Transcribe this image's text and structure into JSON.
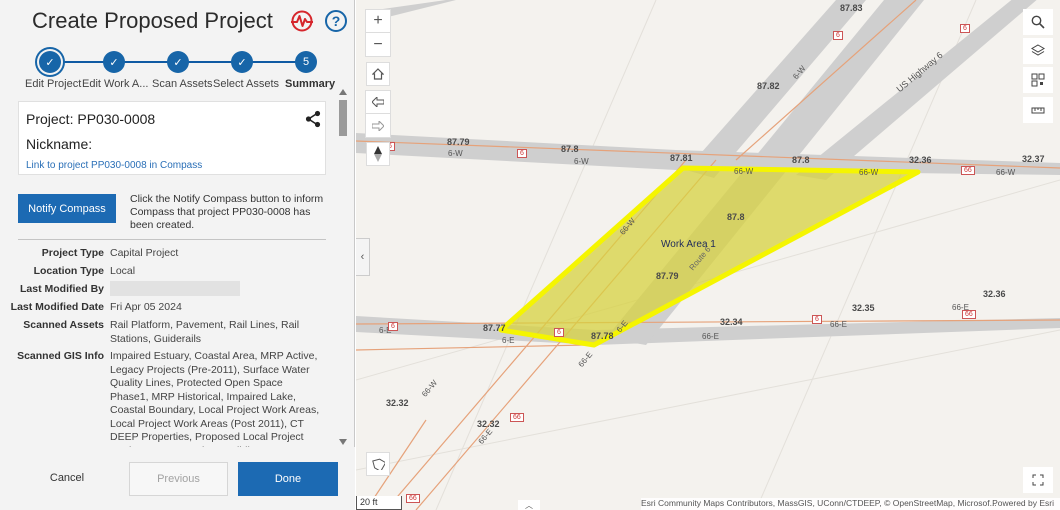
{
  "panel": {
    "title": "Create Proposed Project",
    "steps": [
      {
        "label": "Edit Project",
        "mark": "✓"
      },
      {
        "label": "Edit Work A...",
        "mark": "✓"
      },
      {
        "label": "Scan Assets",
        "mark": "✓"
      },
      {
        "label": "Select Assets",
        "mark": "✓"
      },
      {
        "label": "Summary",
        "mark": "5"
      }
    ],
    "project_label": "Project: PP030-0008",
    "nickname_label": "Nickname:",
    "link_text": "Link to project PP030-0008 in Compass",
    "notify_button": "Notify Compass",
    "notify_text": "Click the Notify Compass button to inform Compass that project PP030-0008 has been created.",
    "details": [
      {
        "key": "Project Type",
        "value": "Capital Project"
      },
      {
        "key": "Location Type",
        "value": "Local"
      },
      {
        "key": "Last Modified By",
        "value": ""
      },
      {
        "key": "Last Modified Date",
        "value": "Fri Apr 05 2024"
      },
      {
        "key": "Scanned Assets",
        "value": "Rail Platform, Pavement, Rail Lines, Rail Stations, Guiderails"
      },
      {
        "key": "Scanned GIS Info",
        "value": "Impaired Estuary, Coastal Area, MRP Active, Legacy Projects (Pre-2011), Surface Water Quality Lines, Protected Open Space Phase1, MRP Historical, Impaired Lake, Coastal Boundary, Local Project Work Areas, Local Project Work Areas (Post 2011), CT DEEP Properties, Proposed Local Project Work Areas, Impervious Buildings,"
      }
    ],
    "footer": {
      "cancel": "Cancel",
      "previous": "Previous",
      "done": "Done"
    },
    "colors": {
      "accent": "#1c6ab3",
      "pulse": "#d6262c"
    }
  },
  "map": {
    "work_area_label": "Work Area 1",
    "elevations": [
      "87.83",
      "87.82",
      "87.79",
      "87.8",
      "87.81",
      "87.8",
      "32.36",
      "32.37",
      "87.8",
      "87.79",
      "32.35",
      "32.36",
      "87.77",
      "87.78",
      "32.34",
      "32.32",
      "32.32"
    ],
    "road_labels": [
      "6-W",
      "6-W",
      "6-W",
      "66-W",
      "66-W",
      "66-W",
      "66-W",
      "US Highway 6",
      "6-E",
      "6-E",
      "6-E",
      "66-E",
      "66-E",
      "66-E",
      "66-E",
      "66-W",
      "66-E",
      "Route 6"
    ],
    "shields": [
      "6",
      "6",
      "6",
      "6",
      "6",
      "66",
      "6",
      "66",
      "66",
      "66",
      "6"
    ],
    "scale": "20 ft",
    "attribution": "Esri Community Maps Contributors, MassGIS, UConn/CTDEEP, © OpenStreetMap, Microsof...",
    "powered_by": "Powered by Esri",
    "highlight_color": "#f5f500"
  }
}
